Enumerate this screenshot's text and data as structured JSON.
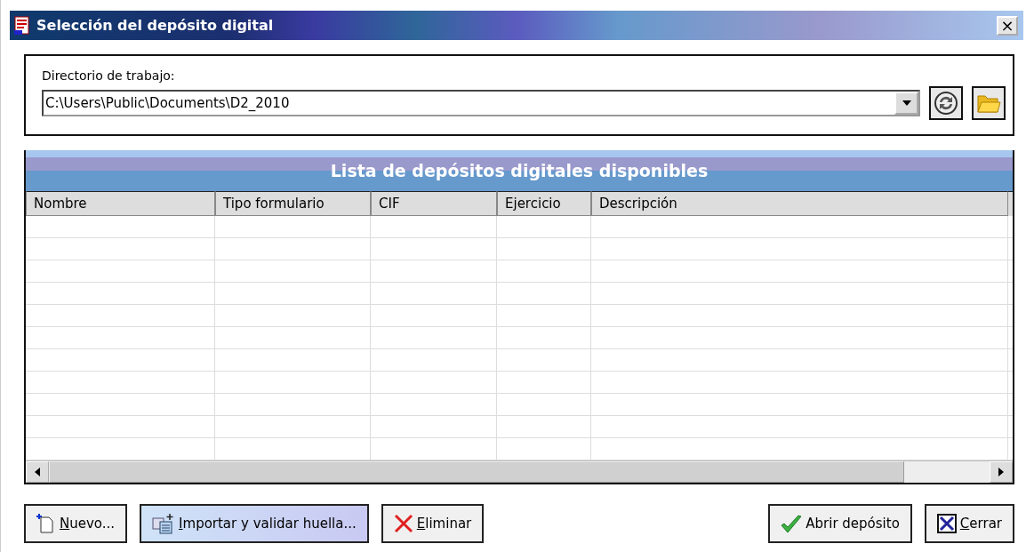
{
  "window": {
    "title": "Selección del depósito digital",
    "close": "×"
  },
  "directory": {
    "label": "Directorio de trabajo:",
    "value": "C:\\Users\\Public\\Documents\\D2_2010"
  },
  "table": {
    "title": "Lista de depósitos digitales disponibles",
    "columns": [
      "Nombre",
      "Tipo formulario",
      "CIF",
      "Ejercicio",
      "Descripción"
    ]
  },
  "buttons": [
    {
      "kind": "new",
      "label": "Nuevo...",
      "mnemonic_underlined": true
    },
    {
      "kind": "import",
      "label": "Importar y validar huella...",
      "mnemonic_underlined": true
    },
    {
      "kind": "delete",
      "label": "Eliminar",
      "mnemonic_underlined": true
    },
    {
      "kind": "open",
      "label": "Abrir depósito",
      "mnemonic_underlined": false
    },
    {
      "kind": "close",
      "label": "Cerrar",
      "mnemonic_underlined": true
    }
  ]
}
